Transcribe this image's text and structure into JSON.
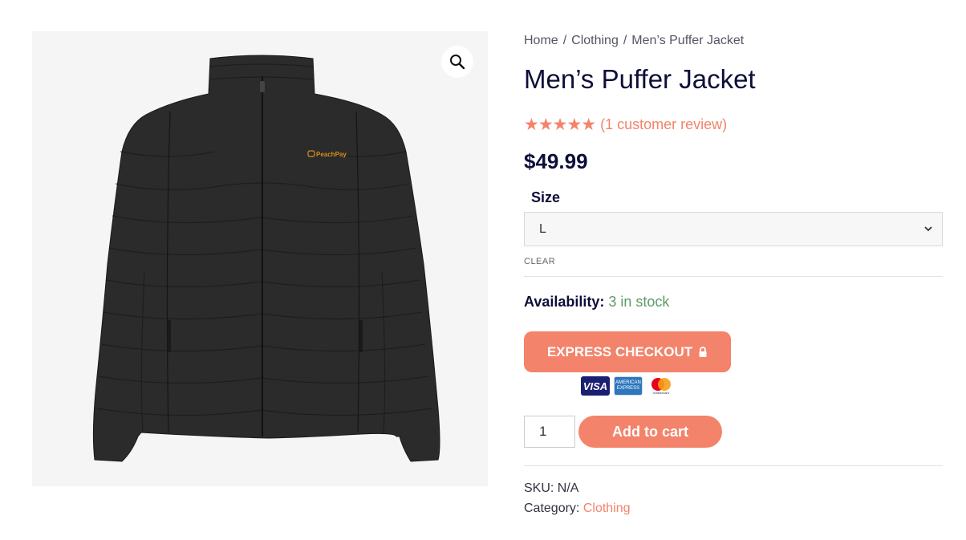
{
  "gallery": {
    "image_alt": "Men's Puffer Jacket",
    "logo_text": "PeachPay",
    "zoom_icon": "magnifier-icon"
  },
  "breadcrumb": {
    "items": [
      "Home",
      "Clothing",
      "Men’s Puffer Jacket"
    ],
    "separator": "/"
  },
  "product": {
    "title": "Men’s Puffer Jacket",
    "rating": {
      "value": 5,
      "max": 5,
      "stars": "★★★★★",
      "review_text": "(1 customer review)"
    },
    "price": "$49.99",
    "variation": {
      "label": "Size",
      "selected": "L",
      "clear_label": "CLEAR"
    },
    "availability": {
      "label": "Availability:",
      "value": "3 in stock"
    },
    "express_checkout": {
      "label": "EXPRESS CHECKOUT",
      "icon": "lock-icon"
    },
    "payment_cards": {
      "visa": "VISA",
      "amex": "AMERICAN EXPRESS",
      "mastercard": "mastercard"
    },
    "quantity": "1",
    "add_to_cart_label": "Add to cart",
    "sku": {
      "label": "SKU:",
      "value": "N/A"
    },
    "category": {
      "label": "Category:",
      "value": "Clothing"
    }
  },
  "colors": {
    "accent": "#f3836a",
    "title": "#0e0e3a",
    "in_stock": "#5d9b63",
    "gallery_bg": "#f5f5f5"
  }
}
